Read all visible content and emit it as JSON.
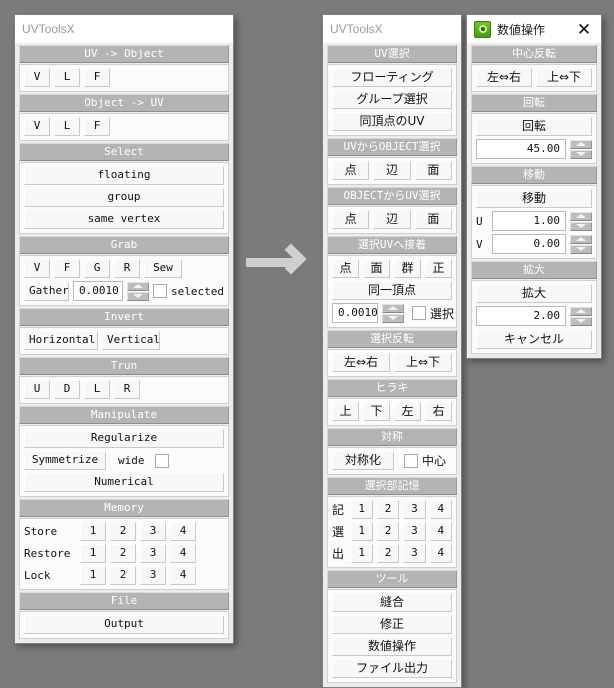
{
  "app": {
    "background_color": "#7b7b7b",
    "arrow_color": "#cfcfcf",
    "header_color": "#b4b4b4",
    "accent_icon_color": "#6fc524"
  },
  "left_panel": {
    "title": "UVToolsX",
    "sections": [
      {
        "header": "UV -> Object",
        "buttons": [
          "V",
          "L",
          "F"
        ]
      },
      {
        "header": "Object -> UV",
        "buttons": [
          "V",
          "L",
          "F"
        ]
      },
      {
        "header": "Select",
        "buttons": [
          "floating",
          "group",
          "same vertex"
        ]
      },
      {
        "header": "Grab",
        "row1": [
          "V",
          "F",
          "G",
          "R",
          "Sew"
        ],
        "gather_label": "Gather",
        "value": "0.0010",
        "checkbox_label": "selected",
        "checked": false
      },
      {
        "header": "Invert",
        "buttons": [
          "Horizontal",
          "Vertical"
        ]
      },
      {
        "header": "Trun",
        "buttons": [
          "U",
          "D",
          "L",
          "R"
        ]
      },
      {
        "header": "Manipulate",
        "regularize": "Regularize",
        "symmetrize": "Symmetrize",
        "wide_label": "wide",
        "wide_checked": false,
        "numerical": "Numerical"
      },
      {
        "header": "Memory",
        "rows": [
          {
            "label": "Store",
            "slots": [
              "1",
              "2",
              "3",
              "4"
            ]
          },
          {
            "label": "Restore",
            "slots": [
              "1",
              "2",
              "3",
              "4"
            ]
          },
          {
            "label": "Lock",
            "slots": [
              "1",
              "2",
              "3",
              "4"
            ]
          }
        ]
      },
      {
        "header": "File",
        "buttons": [
          "Output"
        ]
      }
    ]
  },
  "mid_panel": {
    "title": "UVToolsX",
    "sections": [
      {
        "header": "UV選択",
        "buttons": [
          "フローティング",
          "グループ選択",
          "同頂点のUV"
        ]
      },
      {
        "header": "UVからOBJECT選択",
        "buttons": [
          "点",
          "辺",
          "面"
        ]
      },
      {
        "header": "OBJECTからUV選択",
        "buttons": [
          "点",
          "辺",
          "面"
        ]
      },
      {
        "header": "選択UVへ接着",
        "row1": [
          "点",
          "面",
          "群",
          "正"
        ],
        "same_vertex": "同一頂点",
        "value": "0.0010",
        "checkbox_label": "選択",
        "checked": false
      },
      {
        "header": "選択反転",
        "buttons": [
          "左⇔右",
          "上⇔下"
        ]
      },
      {
        "header": "ヒラキ",
        "buttons": [
          "上",
          "下",
          "左",
          "右"
        ]
      },
      {
        "header": "対称",
        "symmetrize": "対称化",
        "center_label": "中心",
        "center_checked": false
      },
      {
        "header": "選択部記憶",
        "rows": [
          {
            "label": "記",
            "slots": [
              "1",
              "2",
              "3",
              "4"
            ]
          },
          {
            "label": "選",
            "slots": [
              "1",
              "2",
              "3",
              "4"
            ]
          },
          {
            "label": "出",
            "slots": [
              "1",
              "2",
              "3",
              "4"
            ]
          }
        ]
      },
      {
        "header": "ツール",
        "buttons": [
          "縫合",
          "修正",
          "数値操作",
          "ファイル出力"
        ]
      }
    ]
  },
  "right_panel": {
    "title": "数値操作",
    "icon": "green-app-icon",
    "close_glyph": "✕",
    "sections": [
      {
        "header": "中心反転",
        "buttons": [
          "左⇔右",
          "上⇔下"
        ]
      },
      {
        "header": "回転",
        "action": "回転",
        "value": "45.00"
      },
      {
        "header": "移動",
        "action": "移動",
        "fields": [
          {
            "label": "U",
            "value": "1.00"
          },
          {
            "label": "V",
            "value": "0.00"
          }
        ]
      },
      {
        "header": "拡大",
        "action": "拡大",
        "value": "2.00"
      }
    ],
    "cancel_label": "キャンセル"
  }
}
